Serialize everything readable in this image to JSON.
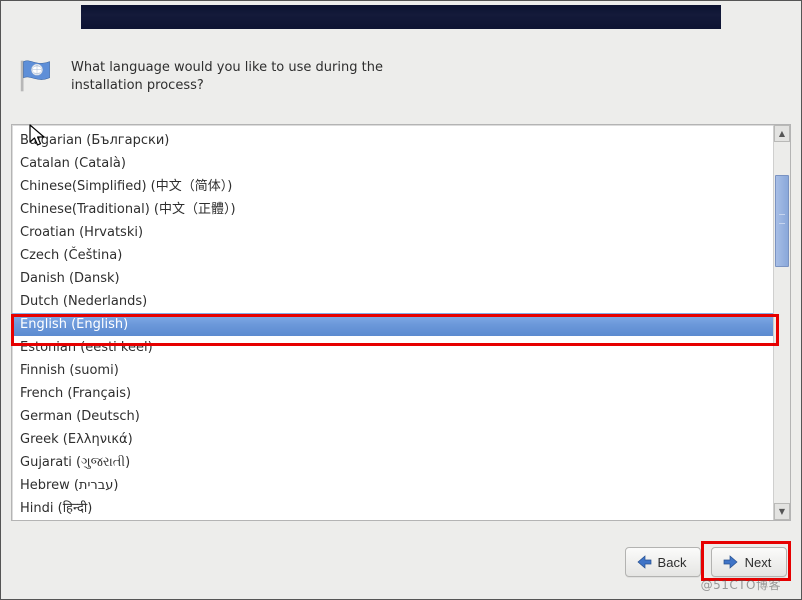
{
  "prompt": {
    "line1": "What language would you like to use during the",
    "line2": "installation process?"
  },
  "languages": [
    "Bulgarian (Български)",
    "Catalan (Català)",
    "Chinese(Simplified) (中文（简体）)",
    "Chinese(Traditional) (中文（正體）)",
    "Croatian (Hrvatski)",
    "Czech (Čeština)",
    "Danish (Dansk)",
    "Dutch (Nederlands)",
    "English (English)",
    "Estonian (eesti keel)",
    "Finnish (suomi)",
    "French (Français)",
    "German (Deutsch)",
    "Greek (Ελληνικά)",
    "Gujarati (ગુજરાતી)",
    "Hebrew (עברית)",
    "Hindi (हिन्दी)"
  ],
  "selected_index": 8,
  "buttons": {
    "back": "Back",
    "next": "Next"
  },
  "watermark": "@51CTO博客"
}
